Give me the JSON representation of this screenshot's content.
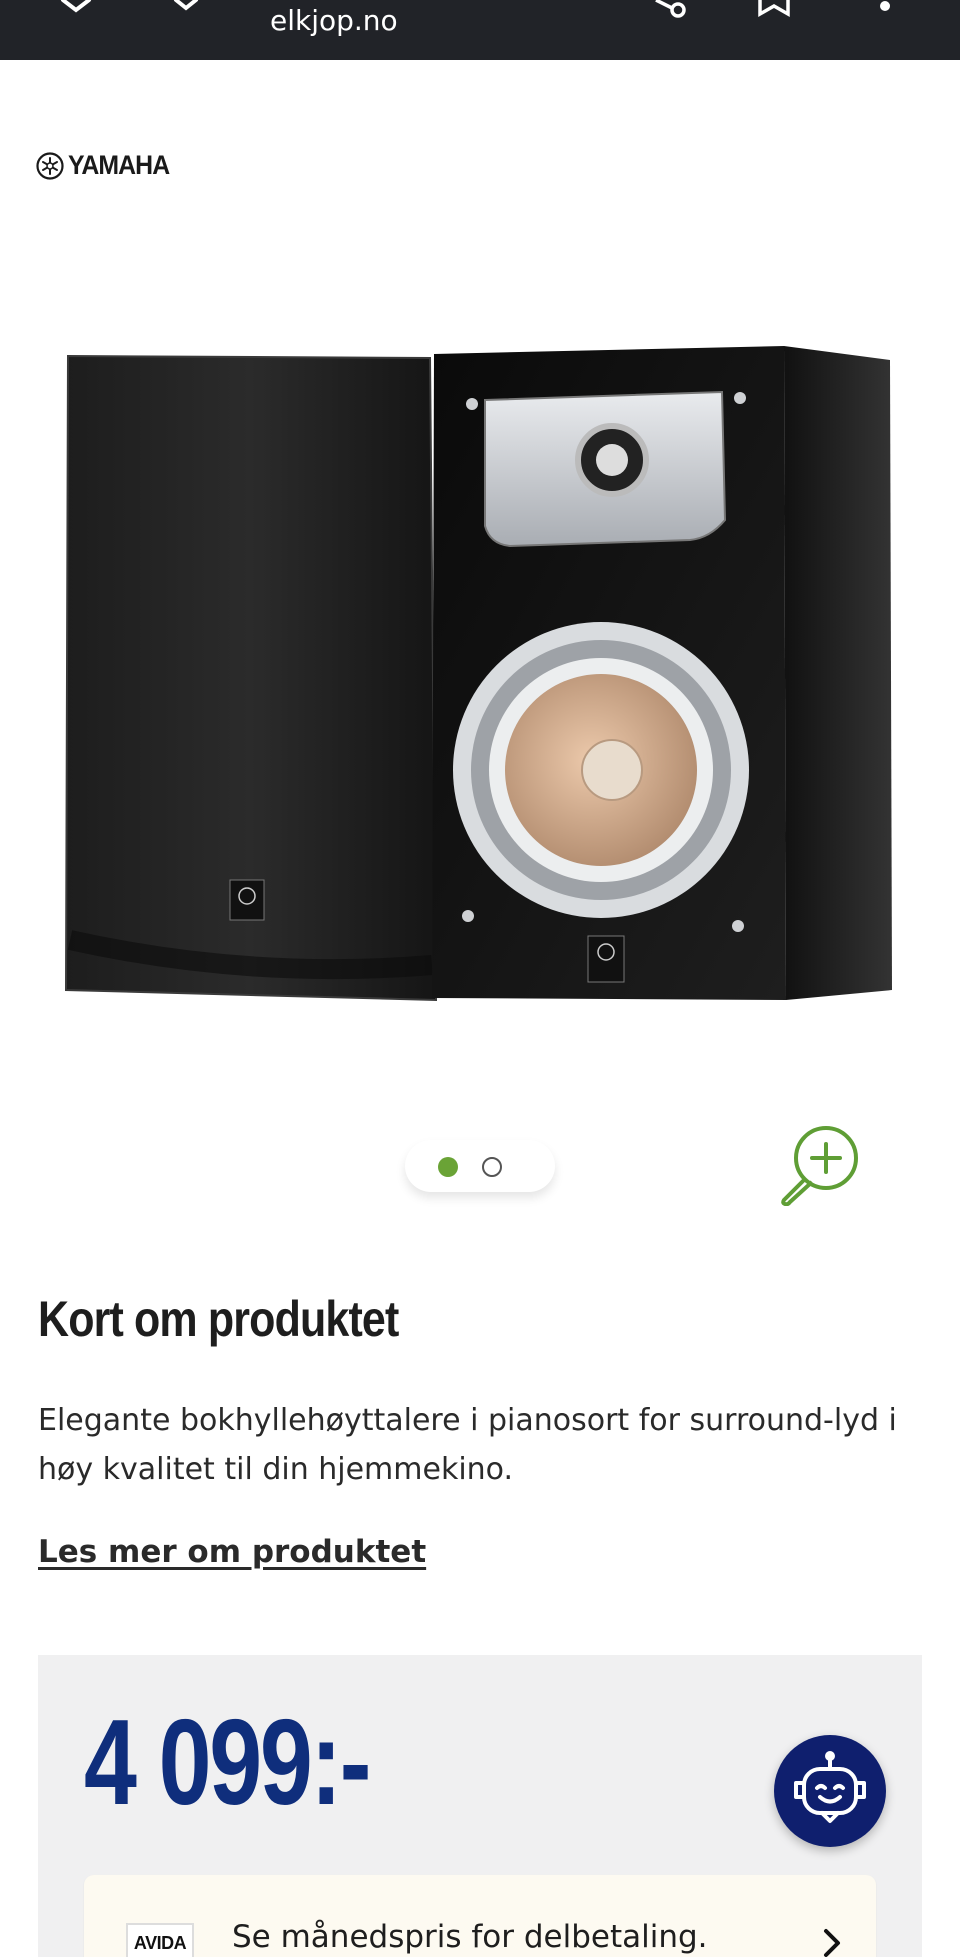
{
  "browser": {
    "url": "elkjop.no",
    "icons": [
      "close-icon",
      "chevron-down-icon",
      "share-icon",
      "bookmark-icon",
      "more-icon"
    ]
  },
  "brand": {
    "name": "YAMAHA",
    "icon": "yamaha-tuning-fork-logo"
  },
  "product_image": {
    "alt": "speaker-image",
    "carousel": {
      "count": 2,
      "active": 1
    }
  },
  "section": {
    "heading": "Kort om produktet",
    "description": "Elegante bokhyllehøyttalere i pianosort for surround-lyd i høy kvalitet til din hjemmekino.",
    "read_more": "Les mer om produktet"
  },
  "price": {
    "amount": "4 099:-",
    "financing": {
      "provider": "AVIDA",
      "text": "Se månedspris for delbetaling."
    }
  },
  "colors": {
    "topbar": "#212328",
    "accent_green": "#6aa336",
    "price_blue": "#0f2e7c",
    "chatbot_navy": "#0f1f6e",
    "price_box_bg": "#f0f0f1"
  }
}
